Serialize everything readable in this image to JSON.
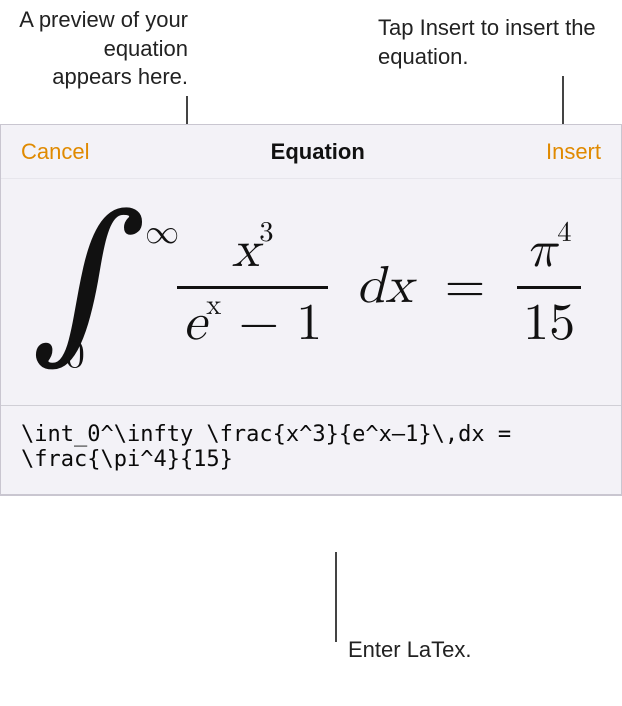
{
  "callouts": {
    "preview": "A preview of\nyour equation\nappears here.",
    "insert": "Tap Insert to\ninsert the equation.",
    "latex": "Enter LaTex."
  },
  "toolbar": {
    "cancel_label": "Cancel",
    "title": "Equation",
    "insert_label": "Insert"
  },
  "equation": {
    "int_symbol": "∫",
    "int_lower": "0",
    "int_upper": "∞",
    "frac1_num_base": "x",
    "frac1_num_exp": "3",
    "frac1_den_e": "e",
    "frac1_den_e_exp": "x",
    "frac1_den_tail": " − 1",
    "dx_d": "d",
    "dx_x": "x",
    "equals": "=",
    "frac2_num_base": "π",
    "frac2_num_exp": "4",
    "frac2_den": "15"
  },
  "latex_source": "\\int_0^\\infty \\frac{x^3}{e^x–1}\\,dx =\n\\frac{\\pi^4}{15}",
  "colors": {
    "accent": "#e08a00"
  }
}
